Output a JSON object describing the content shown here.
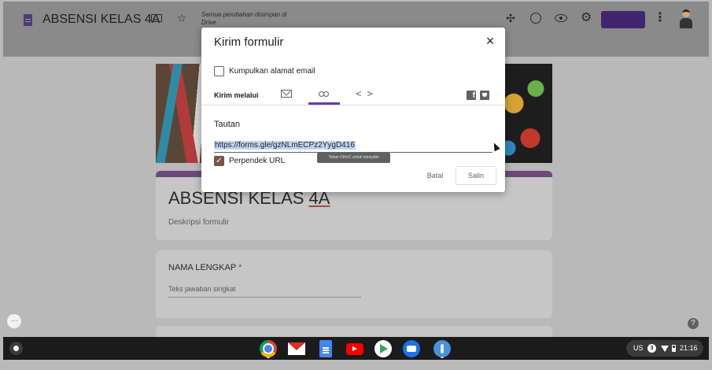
{
  "app": {
    "form_title": "ABSENSI KELAS 4A",
    "save_status": "Semua perubahan disimpan di Drive",
    "accent_color": "#673ab7"
  },
  "form": {
    "title_part1": "ABSENSI KELAS ",
    "title_part2": "4A",
    "description": "Deskripsi formulir",
    "question_label": "NAMA LENGKAP",
    "required_mark": "*",
    "answer_placeholder": "Teks jawaban singkat"
  },
  "dialog": {
    "title": "Kirim formulir",
    "collect_email_label": "Kumpulkan alamat email",
    "collect_email_checked": false,
    "send_via_label": "Kirim melalui",
    "tabs": [
      {
        "name": "email",
        "icon": "envelope-icon",
        "selected": false
      },
      {
        "name": "link",
        "icon": "link-icon",
        "selected": true
      },
      {
        "name": "embed",
        "icon": "embed-code-icon",
        "label": "< >",
        "selected": false
      }
    ],
    "link_section_label": "Tautan",
    "form_url": "https://forms.gle/gzNLmECPz2YygD416",
    "copy_tooltip": "Tekan Ctrl+C untuk menyalin",
    "shorten_url_label": "Perpendek URL",
    "shorten_url_checked": true,
    "cancel_label": "Batal",
    "copy_label": "Salin"
  },
  "icons": {
    "close": "×",
    "more": "⋮",
    "star": "☆",
    "settings": "⚙",
    "addon": "✣",
    "help": "?",
    "chat": "···",
    "check": "✓",
    "facebook": "f"
  },
  "shelf": {
    "apps": [
      "chrome",
      "gmail",
      "google-docs",
      "youtube",
      "play-store",
      "messages",
      "pinned-app"
    ],
    "locale": "US",
    "notification_count": "3",
    "time": "21:16"
  }
}
